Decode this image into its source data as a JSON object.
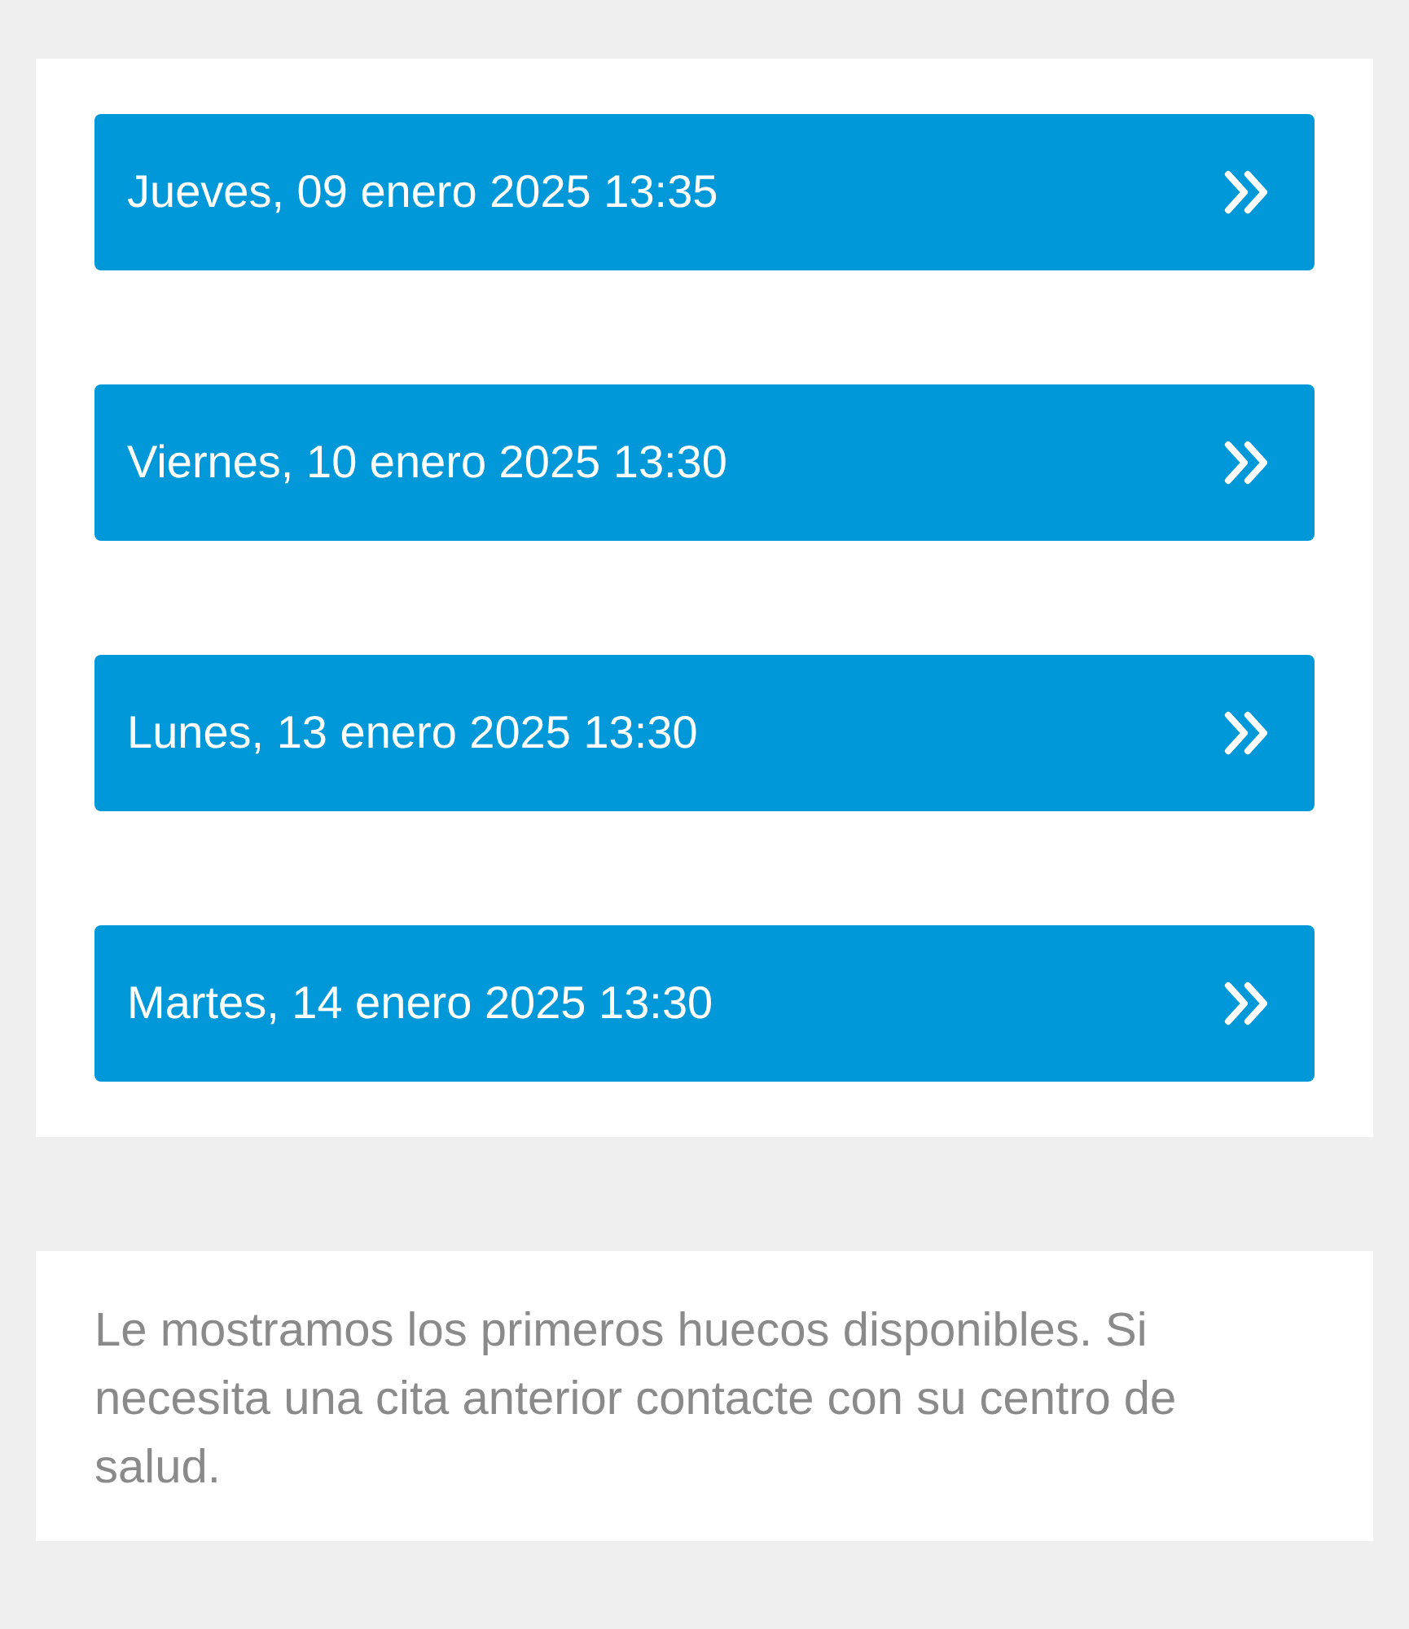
{
  "appointments": [
    {
      "label": "Jueves, 09 enero 2025 13:35"
    },
    {
      "label": "Viernes, 10 enero 2025 13:30"
    },
    {
      "label": "Lunes, 13 enero 2025 13:30"
    },
    {
      "label": "Martes, 14 enero 2025 13:30"
    }
  ],
  "notice": "Le mostramos los primeros huecos disponibles. Si necesita una cita anterior contacte con su centro de salud."
}
